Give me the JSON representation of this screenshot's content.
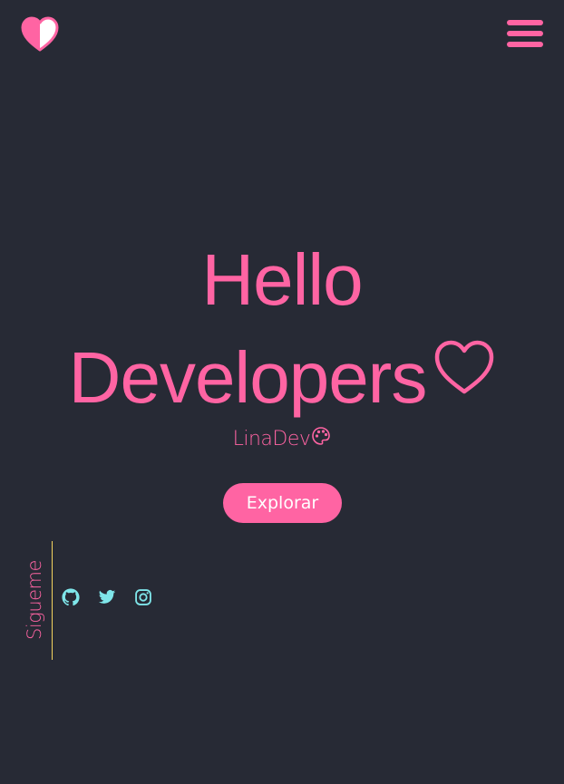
{
  "header": {
    "logo_icon": "half-heart-icon",
    "menu_icon": "hamburger-menu-icon"
  },
  "hero": {
    "title_line1": "Hello",
    "title_line2": "Developers",
    "title_icon": "heart-outline-icon",
    "subtitle": "LinaDev",
    "subtitle_icon": "palette-icon",
    "cta_label": "Explorar"
  },
  "social": {
    "label": "Sigueme",
    "links": [
      {
        "icon": "github-icon"
      },
      {
        "icon": "twitter-icon"
      },
      {
        "icon": "instagram-icon"
      }
    ]
  },
  "colors": {
    "background": "#272a35",
    "accent_pink": "#ff64a3",
    "accent_cyan": "#7fe6ea",
    "divider_yellow": "#f4d35e"
  }
}
